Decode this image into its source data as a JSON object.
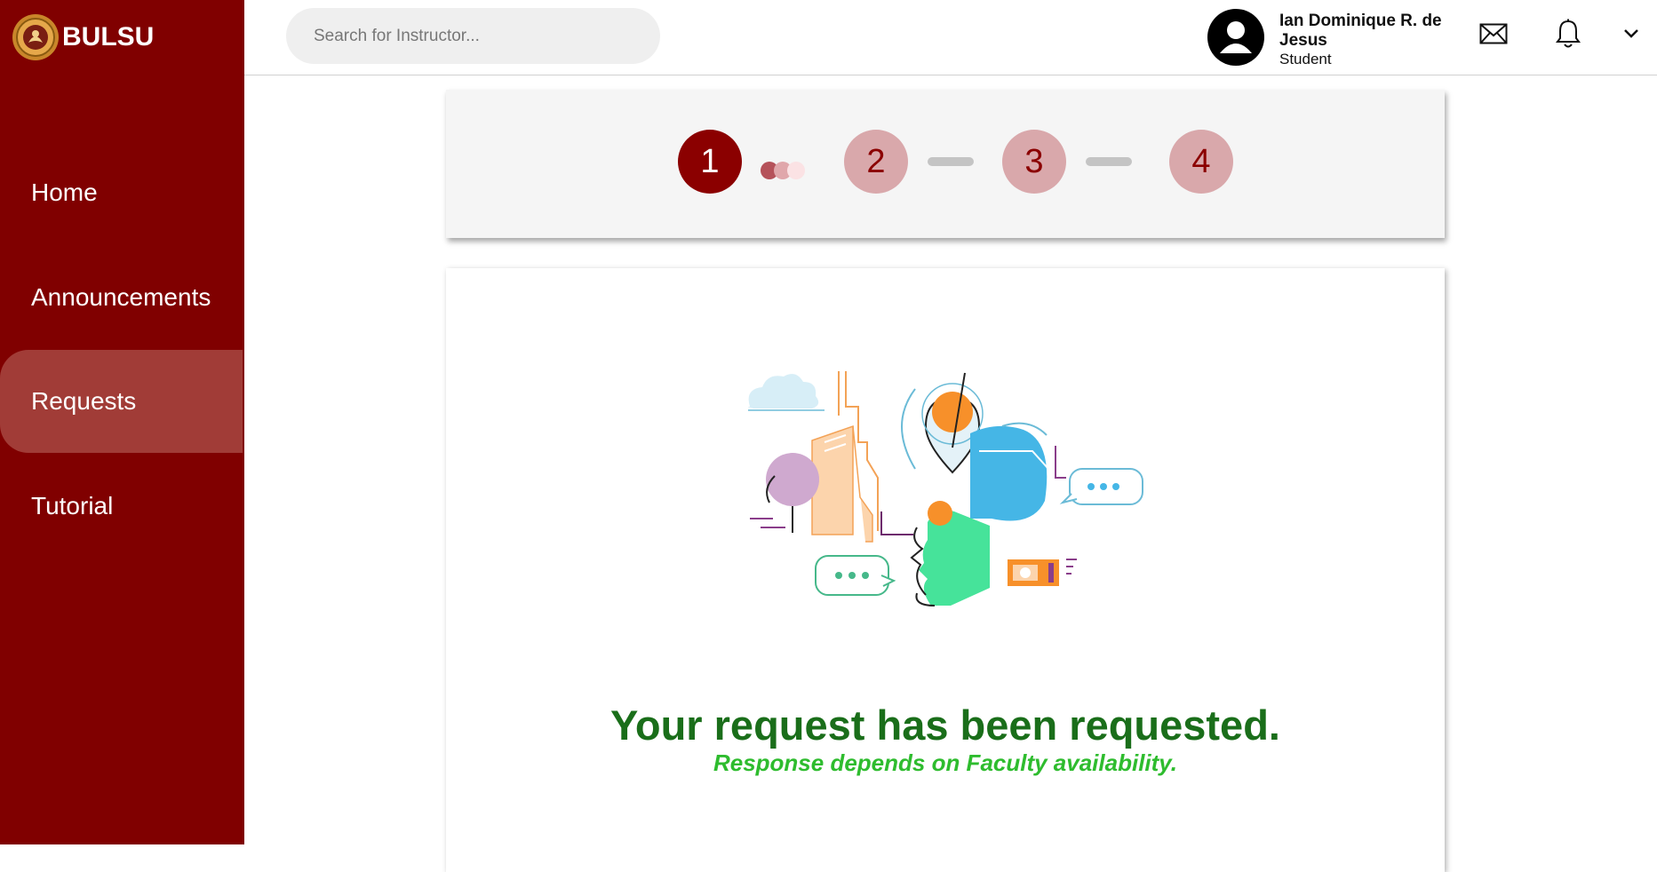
{
  "brand": {
    "name": "BULSU"
  },
  "nav": {
    "items": [
      {
        "label": "Home"
      },
      {
        "label": "Announcements"
      },
      {
        "label": "Requests"
      },
      {
        "label": "Tutorial"
      }
    ]
  },
  "search": {
    "placeholder": "Search for Instructor..."
  },
  "user": {
    "name": "Ian Dominique R. de Jesus",
    "role": "Student"
  },
  "icons": {
    "mail": "mail-icon",
    "bell": "bell-icon",
    "dropdown": "chevron-down-icon"
  },
  "stepper": {
    "steps": [
      "1",
      "2",
      "3",
      "4"
    ],
    "current": 1
  },
  "message": {
    "title": "Your request has been requested.",
    "subtitle": "Response depends on Faculty availability."
  },
  "colors": {
    "sidebar": "#800000",
    "active_nav": "#a13c37",
    "step_current": "#8b0000",
    "step_pending": "#d9a8ab",
    "title": "#1a6e1a",
    "subtitle": "#2ebc2e"
  }
}
